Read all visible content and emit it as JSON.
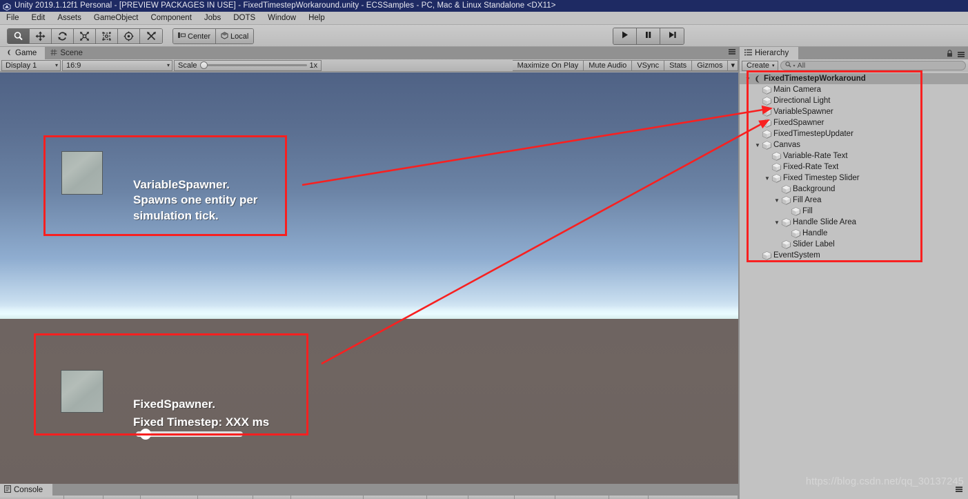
{
  "window": {
    "title": "Unity 2019.1.12f1 Personal - [PREVIEW PACKAGES IN USE] - FixedTimestepWorkaround.unity - ECSSamples - PC, Mac & Linux Standalone <DX11>",
    "app_icon": "unity-icon"
  },
  "menubar": {
    "items": [
      {
        "label": "File"
      },
      {
        "label": "Edit"
      },
      {
        "label": "Assets"
      },
      {
        "label": "GameObject"
      },
      {
        "label": "Component"
      },
      {
        "label": "Jobs"
      },
      {
        "label": "DOTS"
      },
      {
        "label": "Window"
      },
      {
        "label": "Help"
      }
    ]
  },
  "toolbar": {
    "tools": [
      {
        "name": "hand-tool",
        "icon": "magnifier-icon",
        "active": true
      },
      {
        "name": "move-tool",
        "icon": "move-arrows-icon",
        "active": false
      },
      {
        "name": "rotate-tool",
        "icon": "rotate-icon",
        "active": false
      },
      {
        "name": "scale-tool",
        "icon": "scale-icon",
        "active": false
      },
      {
        "name": "rect-tool",
        "icon": "rect-transform-icon",
        "active": false
      },
      {
        "name": "transform-tool",
        "icon": "combined-transform-icon",
        "active": false
      },
      {
        "name": "custom-tool",
        "icon": "custom-editor-tool-icon",
        "active": false
      }
    ],
    "pivot_label": "Center",
    "handle_label": "Local",
    "play_label": "play-button",
    "pause_label": "pause-button",
    "step_label": "step-button"
  },
  "game_panel": {
    "tabs": [
      {
        "label": "Game",
        "icon": "gamepad-icon",
        "active": true
      },
      {
        "label": "Scene",
        "icon": "scene-grid-icon",
        "active": false
      }
    ],
    "display": "Display 1",
    "aspect": "16:9",
    "scale_label": "Scale",
    "scale_value": "1x",
    "maximize_on_play": "Maximize On Play",
    "mute_audio": "Mute Audio",
    "vsync": "VSync",
    "stats": "Stats",
    "gizmos": "Gizmos"
  },
  "game_content": {
    "variable_spawner_text": "VariableSpawner.\nSpawns one entity per\nsimulation tick.",
    "fixed_spawner_title": "FixedSpawner.",
    "fixed_timestep_label": "Fixed Timestep: XXX ms",
    "slider_value_percent": 4
  },
  "hierarchy": {
    "tab_label": "Hierarchy",
    "create_label": "Create",
    "search_placeholder": "All",
    "search_value": "",
    "items": [
      {
        "label": "FixedTimestepWorkaround",
        "depth": 0,
        "twisty": "down",
        "icon": "scene-icon",
        "selected": true
      },
      {
        "label": "Main Camera",
        "depth": 1,
        "twisty": "",
        "icon": "gameobject-icon",
        "selected": false
      },
      {
        "label": "Directional Light",
        "depth": 1,
        "twisty": "",
        "icon": "gameobject-icon",
        "selected": false
      },
      {
        "label": "VariableSpawner",
        "depth": 1,
        "twisty": "",
        "icon": "gameobject-icon",
        "selected": false
      },
      {
        "label": "FixedSpawner",
        "depth": 1,
        "twisty": "",
        "icon": "gameobject-icon",
        "selected": false
      },
      {
        "label": "FixedTimestepUpdater",
        "depth": 1,
        "twisty": "",
        "icon": "gameobject-icon",
        "selected": false
      },
      {
        "label": "Canvas",
        "depth": 1,
        "twisty": "down",
        "icon": "gameobject-icon",
        "selected": false
      },
      {
        "label": "Variable-Rate Text",
        "depth": 2,
        "twisty": "",
        "icon": "gameobject-icon",
        "selected": false
      },
      {
        "label": "Fixed-Rate Text",
        "depth": 2,
        "twisty": "",
        "icon": "gameobject-icon",
        "selected": false
      },
      {
        "label": "Fixed Timestep Slider",
        "depth": 2,
        "twisty": "down",
        "icon": "gameobject-icon",
        "selected": false
      },
      {
        "label": "Background",
        "depth": 3,
        "twisty": "",
        "icon": "gameobject-icon",
        "selected": false
      },
      {
        "label": "Fill Area",
        "depth": 3,
        "twisty": "down",
        "icon": "gameobject-icon",
        "selected": false
      },
      {
        "label": "Fill",
        "depth": 4,
        "twisty": "",
        "icon": "gameobject-icon",
        "selected": false
      },
      {
        "label": "Handle Slide Area",
        "depth": 3,
        "twisty": "down",
        "icon": "gameobject-icon",
        "selected": false
      },
      {
        "label": "Handle",
        "depth": 4,
        "twisty": "",
        "icon": "gameobject-icon",
        "selected": false
      },
      {
        "label": "Slider Label",
        "depth": 3,
        "twisty": "",
        "icon": "gameobject-icon",
        "selected": false
      },
      {
        "label": "EventSystem",
        "depth": 1,
        "twisty": "",
        "icon": "gameobject-icon",
        "selected": false
      }
    ]
  },
  "console": {
    "tab_label": "Console",
    "tab_icon": "console-icon"
  },
  "watermark": {
    "text": "https://blog.csdn.net/qq_30137245"
  },
  "annotation": {
    "color": "#f82020"
  }
}
